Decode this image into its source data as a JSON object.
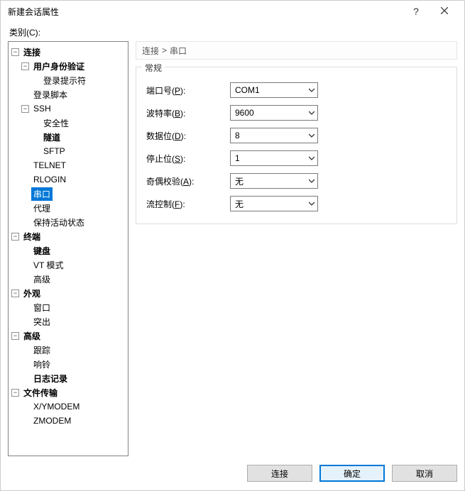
{
  "window": {
    "title": "新建会话属性",
    "help_title": "帮助",
    "close_title": "关闭"
  },
  "category_label": "类别(C):",
  "breadcrumb": {
    "root": "连接",
    "sep": ">",
    "leaf": "串口"
  },
  "tree": {
    "connection": "连接",
    "auth": "用户身份验证",
    "login_prompt": "登录提示符",
    "login_script": "登录脚本",
    "ssh": "SSH",
    "security": "安全性",
    "tunnel": "隧道",
    "sftp": "SFTP",
    "telnet": "TELNET",
    "rlogin": "RLOGIN",
    "serial": "串口",
    "proxy": "代理",
    "keepalive": "保持活动状态",
    "terminal": "终端",
    "keyboard": "键盘",
    "vtmode": "VT 模式",
    "advanced1": "高级",
    "appearance": "外观",
    "window": "窗口",
    "highlight": "突出",
    "advanced2": "高级",
    "trace": "跟踪",
    "bell": "响铃",
    "logging": "日志记录",
    "filetransfer": "文件传输",
    "xymodem": "X/YMODEM",
    "zmodem": "ZMODEM"
  },
  "group": {
    "legend": "常规"
  },
  "fields": {
    "port": {
      "label_pre": "端口号(",
      "key": "P",
      "label_post": "):",
      "value": "COM1"
    },
    "baud": {
      "label_pre": "波特率(",
      "key": "B",
      "label_post": "):",
      "value": "9600"
    },
    "databits": {
      "label_pre": "数据位(",
      "key": "D",
      "label_post": "):",
      "value": "8"
    },
    "stopbits": {
      "label_pre": "停止位(",
      "key": "S",
      "label_post": "):",
      "value": "1"
    },
    "parity": {
      "label_pre": "奇偶校验(",
      "key": "A",
      "label_post": "):",
      "value": "无"
    },
    "flow": {
      "label_pre": "流控制(",
      "key": "F",
      "label_post": "):",
      "value": "无"
    }
  },
  "buttons": {
    "connect": "连接",
    "ok": "确定",
    "cancel": "取消"
  }
}
